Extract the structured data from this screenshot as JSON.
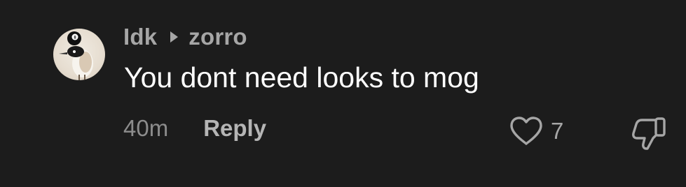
{
  "comment": {
    "author": "Idk",
    "reply_to": "zorro",
    "text": "You dont need looks to mog",
    "age": "40m",
    "reply_label": "Reply",
    "like_count": "7"
  },
  "icons": {
    "avatar": "bird-with-8-ball-avatar",
    "reply_arrow": "caret-right-icon",
    "like": "heart-outline-icon",
    "dislike": "thumbs-down-outline-icon"
  },
  "colors": {
    "background": "#1c1c1c",
    "primary_text": "#ffffff",
    "secondary_text": "#a6a6a6",
    "muted_text": "#8c8c8c"
  }
}
